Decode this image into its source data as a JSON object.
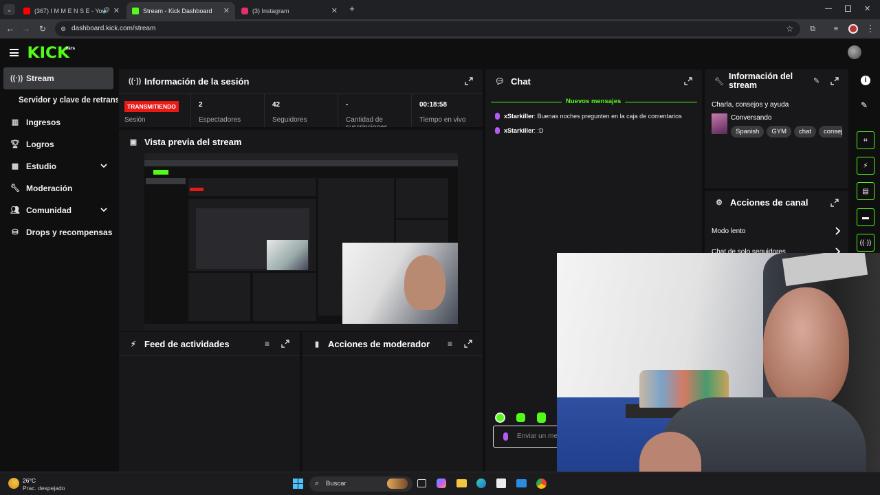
{
  "browser": {
    "tabs": [
      {
        "label": "(367) I M M E N S E - You",
        "favicon_color": "#ff0000"
      },
      {
        "label": "Stream - Kick Dashboard",
        "favicon_color": "#53fc18"
      },
      {
        "label": "(3) Instagram",
        "favicon_color": "#e1306c"
      }
    ],
    "url": "dashboard.kick.com/stream"
  },
  "logo": {
    "text": "KICK",
    "badge": "BETA"
  },
  "sidebar": {
    "items": [
      {
        "label": "Stream",
        "icon": "stream-icon"
      },
      {
        "label": "Servidor y clave de retransmisión",
        "icon": ""
      },
      {
        "label": "Ingresos",
        "icon": "revenue-icon"
      },
      {
        "label": "Logros",
        "icon": "trophy-icon"
      },
      {
        "label": "Estudio",
        "icon": "studio-icon"
      },
      {
        "label": "Moderación",
        "icon": "wrench-icon"
      },
      {
        "label": "Comunidad",
        "icon": "community-icon"
      },
      {
        "label": "Drops y recompensas",
        "icon": "drops-icon"
      }
    ]
  },
  "session": {
    "title": "Información de la sesión",
    "status_badge": "TRANSMITIENDO",
    "status_label": "Sesión",
    "stats": [
      {
        "value": "2",
        "label": "Espectadores"
      },
      {
        "value": "42",
        "label": "Seguidores"
      },
      {
        "value": "-",
        "label": "Cantidad de suscripciones"
      },
      {
        "value": "00:18:58",
        "label": "Tiempo en vivo"
      }
    ]
  },
  "preview": {
    "title": "Vista previa del stream"
  },
  "feed": {
    "title": "Feed de actividades"
  },
  "modactions": {
    "title": "Acciones de moderador"
  },
  "chat": {
    "title": "Chat",
    "new_messages": "Nuevos mensajes",
    "messages": [
      {
        "user": "xStarkiller",
        "text": "Buenas noches pregunten en la caja de comentarios"
      },
      {
        "user": "xStarkiller",
        "text": ":D"
      }
    ],
    "input_placeholder": "Enviar un mensaje"
  },
  "stream_info": {
    "title": "Información del stream",
    "stream_title": "Charla, consejos y ayuda",
    "category": "Conversando",
    "tags": [
      "Spanish",
      "GYM",
      "chat",
      "consejos"
    ]
  },
  "channel_actions": {
    "title": "Acciones de canal",
    "items": [
      "Modo lento",
      "Chat de solo seguidores"
    ]
  },
  "taskbar": {
    "weather_temp": "26°C",
    "weather_desc": "Prac. despejado",
    "search_placeholder": "Buscar"
  },
  "colors": {
    "accent": "#53fc18",
    "live": "#e91916",
    "panel": "#18181a",
    "bg": "#0f0f10"
  }
}
